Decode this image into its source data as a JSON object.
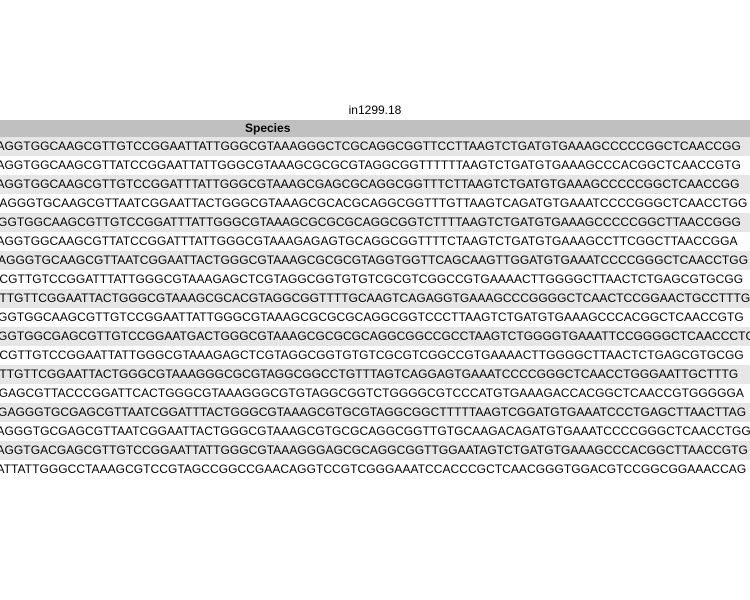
{
  "caption": "in1299.18",
  "table": {
    "header": "Species",
    "rows": [
      "TAGGTGGCAAGCGTTGTCCGGAATTATTGGGCGTAAAGGGCTCGCAGGCGGTTCCTTAAGTCTGATGTGAAAGCCCCCGGCTCAACCGG",
      "TAGGTGGCAAGCGTTATCCGGAATTATTGGGCGTAAAGCGCGCGTAGGCGGTTTTTTAAGTCTGATGTGAAAGCCCACGGCTCAACCGTG",
      "TAGGTGGCAAGCGTTGTCCGGATTTATTGGGCGTAAAGCGAGCGCAGGCGGTTTCTTAAGTCTGATGTGAAAGCCCCCGGCTCAACCGG",
      "GAGGGTGCAAGCGTTAATCGGAATTACTGGGCGTAAAGCGCACGCAGGCGGTTTGTTAAGTCAGATGTGAAATCCCCGGGCTCAACCTGG",
      "AGGTGGCAAGCGTTGTCCGGATTTATTGGGCGTAAAGCGCGCGCAGGCGGTCTTTTAAGTCTGATGTGAAAGCCCCCGGCTTAACCGGG",
      "TAGGTGGCAAGCGTTATCCGGATTTATTGGGCGTAAAGAGAGTGCAGGCGGTTTTCTAAGTCTGATGTGAAAGCCTTCGGCTTAACCGGA",
      "AAGGGTGCAAGCGTTAATCGGAATTACTGGGCGTAAAGCGCGCGTAGGTGGTTCAGCAAGTTGGATGTGAAATCCCCGGGCTCAACCTGG",
      "GCGTTGTCCGGATTTATTGGGCGTAAAGAGCTCGTAGGCGGTGTGTCGCGTCGGCCGTGAAAACTTGGGGCTTAACTCTGAGCGTGCGG",
      "GTTGTTCGGAATTACTGGGCGTAAAGCGCACGTAGGCGGTTTTGCAAGTCAGAGGTGAAAGCCCGGGGCTCAACTCCGGAACTGCCTTTG",
      "AGGTGGCAAGCGTTGTCCGGAATTATTGGGCGTAAAGCGCGCGCAGGCGGTCCCTTAAGTCTGATGTGAAAGCCCACGGCTCAACCGTG",
      "AGGTGGCGAGCGTTGTCCGGAATGACTGGGCGTAAAGCGCGCGCAGGCGGCCGCCTAAGTCTGGGGTGAAATTCCGGGGCTCAACCCTG",
      "GCGTTGTCCGGAATTATTGGGCGTAAAGAGCTCGTAGGCGGTGTGTCGCGTCGGCCGTGAAAACTTGGGGCTTAACTCTGAGCGTGCGG",
      "GTTGTTCGGAATTACTGGGCGTAAAGGGCGCGTAGGCGGCCTGTTTAGTCAGGAGTGAAATCCCCGGGCTCAACCTGGGAATTGCTTTG",
      "CGAGCGTTACCCGGATTCACTGGGCGTAAAGGGCGTGTAGGCGGTCTGGGGCGTCCCATGTGAAAGACCACGGCTCAACCGTGGGGGA",
      "AGAGGGTGCGAGCGTTAATCGGATTTACTGGGCGTAAAGCGTGCGTAGGCGGCTTTTTAAGTCGGATGTGAAATCCCTGAGCTTAACTTAG",
      "TAGGGTGCGAGCGTTAATCGGAATTACTGGGCGTAAAGCGTGCGCAGGCGGTTGTGCAAGACAGATGTGAAATCCCCGGGCTCAACCTGG",
      "TAGGTGACGAGCGTTGTCCGGAATTATTGGGCGTAAAGGGAGCGCAGGCGGTTGGAATAGTCTGATGTGAAAGCCCACGGCTTAACCGTG",
      "TATTATTGGGCCTAAAGCGTCCGTAGCCGGCCGAACAGGTCCGTCGGGAAATCCACCCGCTCAACGGGTGGACGTCCGGCGGAAACCAG"
    ]
  }
}
